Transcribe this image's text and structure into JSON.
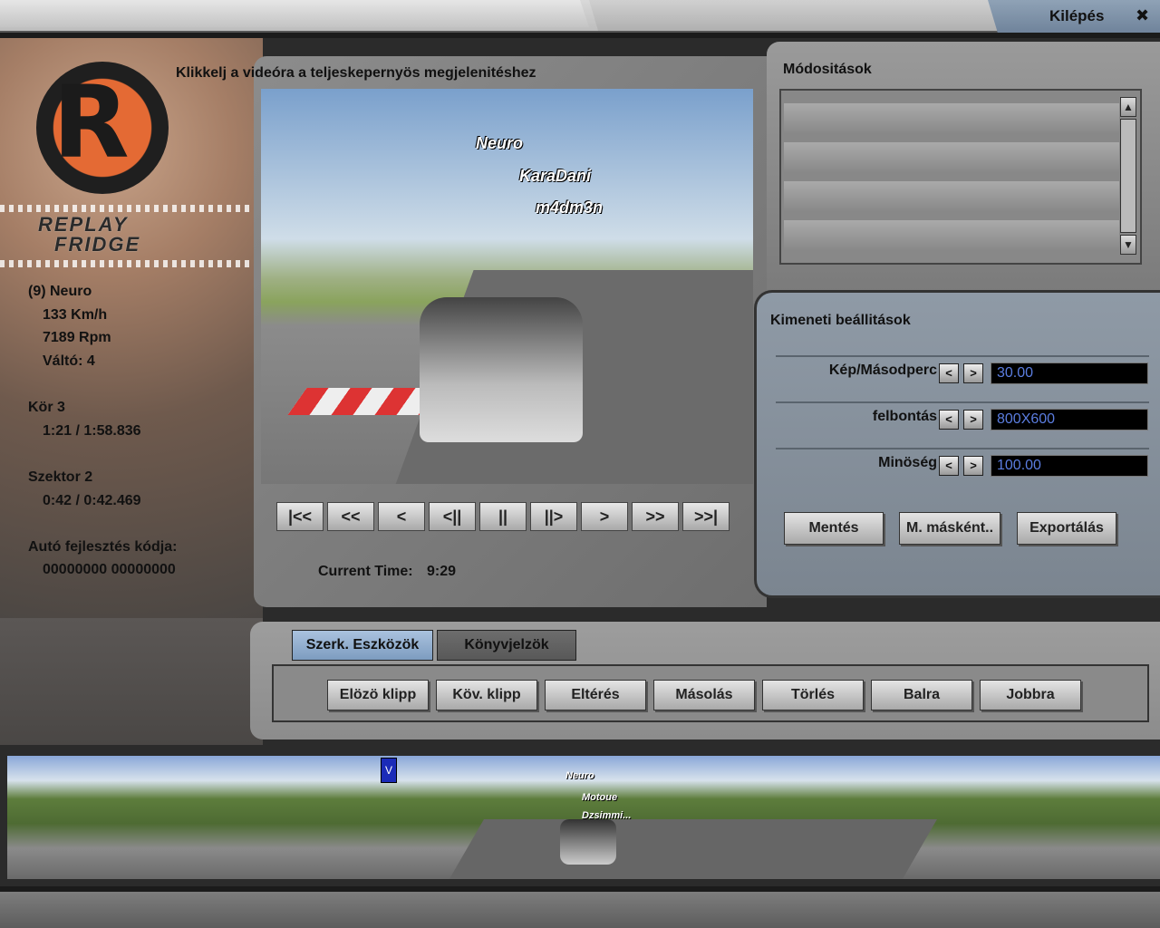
{
  "header": {
    "exit_label": "Kilépés",
    "exit_icon": "close-icon"
  },
  "brand": {
    "line1": "REPLAY",
    "line2": "FRIDGE"
  },
  "driver_info": {
    "driver": "(9) Neuro",
    "speed": "133 Km/h",
    "rpm": "7189 Rpm",
    "gear": "Váltó: 4",
    "lap_label": "Kör 3",
    "lap_time": "1:21 / 1:58.836",
    "sector_label": "Szektor 2",
    "sector_time": "0:42 / 0:42.469",
    "car_code_label": "Autó fejlesztés kódja:",
    "car_code": "00000000 00000000"
  },
  "video": {
    "hint": "Klikkelj a videóra a teljeskepernyös megjelenitéshez",
    "names": [
      "Neuro",
      "KaraDani",
      "m4dm3n"
    ],
    "current_time_label": "Current Time:",
    "current_time_value": "9:29"
  },
  "transport": [
    {
      "name": "go-to-start-button",
      "glyph": "|<<"
    },
    {
      "name": "fast-rewind-button",
      "glyph": "<<"
    },
    {
      "name": "rewind-button",
      "glyph": "<"
    },
    {
      "name": "step-back-button",
      "glyph": "<||"
    },
    {
      "name": "pause-button",
      "glyph": "||"
    },
    {
      "name": "step-forward-button",
      "glyph": "||>"
    },
    {
      "name": "play-button",
      "glyph": ">"
    },
    {
      "name": "fast-forward-button",
      "glyph": ">>"
    },
    {
      "name": "go-to-end-button",
      "glyph": ">>|"
    }
  ],
  "modifications": {
    "title": "Módositások"
  },
  "output": {
    "title": "Kimeneti beállitások",
    "fps_label": "Kép/Másodperc",
    "fps_value": "30.00",
    "resolution_label": "felbontás",
    "resolution_value": "800X600",
    "quality_label": "Minöség",
    "quality_value": "100.00",
    "save_label": "Mentés",
    "save_as_label": "M. másként..",
    "export_label": "Exportálás"
  },
  "editor": {
    "tab_tools": "Szerk. Eszközök",
    "tab_bookmarks": "Könyvjelzök",
    "prev_clip": "Elözö klipp",
    "next_clip": "Köv. klipp",
    "split": "Eltérés",
    "copy": "Másolás",
    "delete": "Törlés",
    "left": "Balra",
    "right": "Jobbra"
  },
  "timeline": {
    "names": [
      "Neuro",
      "Motoue",
      "Dzsimmi..."
    ],
    "marker_glyph": "V"
  },
  "colors": {
    "logo_orange": "#e46a34",
    "field_text": "#5b7de0",
    "active_tab": "#8fa9c9"
  }
}
